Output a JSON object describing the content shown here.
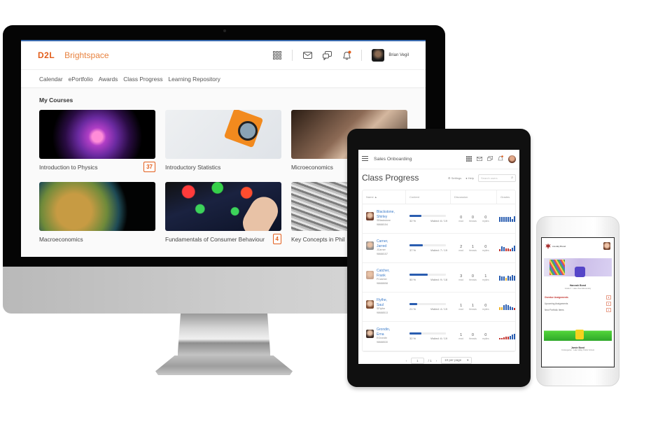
{
  "desktop": {
    "brand": {
      "logo": "D2L",
      "product": "Brightspace"
    },
    "header_icons": [
      "apps-grid-icon",
      "mail-icon",
      "chat-icon",
      "bell-icon"
    ],
    "user": {
      "name": "Brian Vegil"
    },
    "nav": [
      "Calendar",
      "ePortfolio",
      "Awards",
      "Class Progress",
      "Learning Repository"
    ],
    "section_title": "My Courses",
    "courses": [
      {
        "title": "Introduction to Physics",
        "badge": "37"
      },
      {
        "title": "Introductory Statistics",
        "badge": null
      },
      {
        "title": "Microeconomics",
        "badge": null
      },
      {
        "title": "Macroeconomics",
        "badge": null
      },
      {
        "title": "Fundamentals of Consumer Behaviour",
        "badge": "4"
      },
      {
        "title": "Key Concepts in Phil",
        "badge": null
      }
    ]
  },
  "tablet": {
    "course_name": "Sales Onboarding",
    "page_title": "Class Progress",
    "settings_label": "Settings",
    "help_label": "Help",
    "search_placeholder": "Search users",
    "columns": [
      "Name ▲",
      "Content",
      "Discussion",
      "Grades"
    ],
    "disc_labels": {
      "read": "read",
      "threads": "threads",
      "replies": "replies"
    },
    "students": [
      {
        "name_last": "Blackstone,",
        "name_first": "Shirley",
        "username": "SBlackstone",
        "id": "98688154",
        "progress": 32,
        "pct": "32 %",
        "visited": "Visited: 6 / 19",
        "read": "0",
        "threads": "0",
        "replies": "0",
        "grades": [
          {
            "v": 0.8,
            "c": "#2a5db0"
          },
          {
            "v": 0.8,
            "c": "#2a5db0"
          },
          {
            "v": 0.8,
            "c": "#2a5db0"
          },
          {
            "v": 0.8,
            "c": "#2a5db0"
          },
          {
            "v": 0.8,
            "c": "#2a5db0"
          },
          {
            "v": 0.8,
            "c": "#2a5db0"
          },
          {
            "v": 0.5,
            "c": "#2a5db0"
          },
          {
            "v": 0.9,
            "c": "#2a5db0"
          }
        ]
      },
      {
        "name_last": "Carner,",
        "name_first": "Jarred",
        "username": "JCarner",
        "id": "98688157",
        "progress": 37,
        "pct": "37 %",
        "visited": "Visited: 7 / 19",
        "read": "2",
        "threads": "1",
        "replies": "0",
        "grades": [
          {
            "v": 0.3,
            "c": "#c0302b"
          },
          {
            "v": 0.8,
            "c": "#2a5db0"
          },
          {
            "v": 0.7,
            "c": "#2a5db0"
          },
          {
            "v": 0.5,
            "c": "#c0302b"
          },
          {
            "v": 0.4,
            "c": "#c0302b"
          },
          {
            "v": 0.3,
            "c": "#c0302b"
          },
          {
            "v": 0.6,
            "c": "#2a5db0"
          },
          {
            "v": 0.9,
            "c": "#2a5db0"
          }
        ]
      },
      {
        "name_last": "Catcher,",
        "name_first": "Frank",
        "username": "FCatcher",
        "id": "98688658",
        "progress": 50,
        "pct": "50 %",
        "visited": "Visited: 9 / 18",
        "read": "3",
        "threads": "0",
        "replies": "1",
        "grades": [
          {
            "v": 0.8,
            "c": "#2a5db0"
          },
          {
            "v": 0.7,
            "c": "#2a5db0"
          },
          {
            "v": 0.7,
            "c": "#2a5db0"
          },
          {
            "v": 0.5,
            "c": "#f0b429"
          },
          {
            "v": 0.8,
            "c": "#2a5db0"
          },
          {
            "v": 0.7,
            "c": "#2a5db0"
          },
          {
            "v": 0.9,
            "c": "#2a5db0"
          },
          {
            "v": 0.8,
            "c": "#2a5db0"
          }
        ]
      },
      {
        "name_last": "Flythe,",
        "name_first": "Saul",
        "username": "SFlythe",
        "id": "98688513",
        "progress": 21,
        "pct": "21 %",
        "visited": "Visited: 4 / 19",
        "read": "1",
        "threads": "1",
        "replies": "0",
        "grades": [
          {
            "v": 0.4,
            "c": "#f0b429"
          },
          {
            "v": 0.5,
            "c": "#f0b429"
          },
          {
            "v": 0.8,
            "c": "#2a5db0"
          },
          {
            "v": 0.9,
            "c": "#2a5db0"
          },
          {
            "v": 0.8,
            "c": "#2a5db0"
          },
          {
            "v": 0.6,
            "c": "#2a5db0"
          },
          {
            "v": 0.4,
            "c": "#2a5db0"
          },
          {
            "v": 0.3,
            "c": "#c0302b"
          }
        ]
      },
      {
        "name_last": "Grondin,",
        "name_first": "Erna",
        "username": "EGrondin",
        "id": "98688530",
        "progress": 32,
        "pct": "32 %",
        "visited": "Visited: 6 / 19",
        "read": "1",
        "threads": "0",
        "replies": "0",
        "grades": [
          {
            "v": 0.2,
            "c": "#c0302b"
          },
          {
            "v": 0.2,
            "c": "#c0302b"
          },
          {
            "v": 0.3,
            "c": "#c0302b"
          },
          {
            "v": 0.4,
            "c": "#c0302b"
          },
          {
            "v": 0.5,
            "c": "#c0302b"
          },
          {
            "v": 0.6,
            "c": "#2a5db0"
          },
          {
            "v": 0.8,
            "c": "#2a5db0"
          },
          {
            "v": 1.0,
            "c": "#2a5db0"
          }
        ]
      }
    ],
    "pager": {
      "page": "1",
      "of": "/ 1",
      "per_page": "10 per page"
    }
  },
  "phone": {
    "school": "Literally Brand",
    "student_name": "Hannah Bond",
    "student_sub": "Grade 4 · Lake View Elementary",
    "items": [
      {
        "label": "Overdue Assignments",
        "count": "1",
        "active": true
      },
      {
        "label": "Upcoming Assignments",
        "count": "4",
        "active": false
      },
      {
        "label": "New Portfolio Items",
        "count": "2",
        "active": false
      }
    ],
    "second_student": "Jamie Bond",
    "second_sub": "Kindergarten · Lake Valley Public School"
  }
}
